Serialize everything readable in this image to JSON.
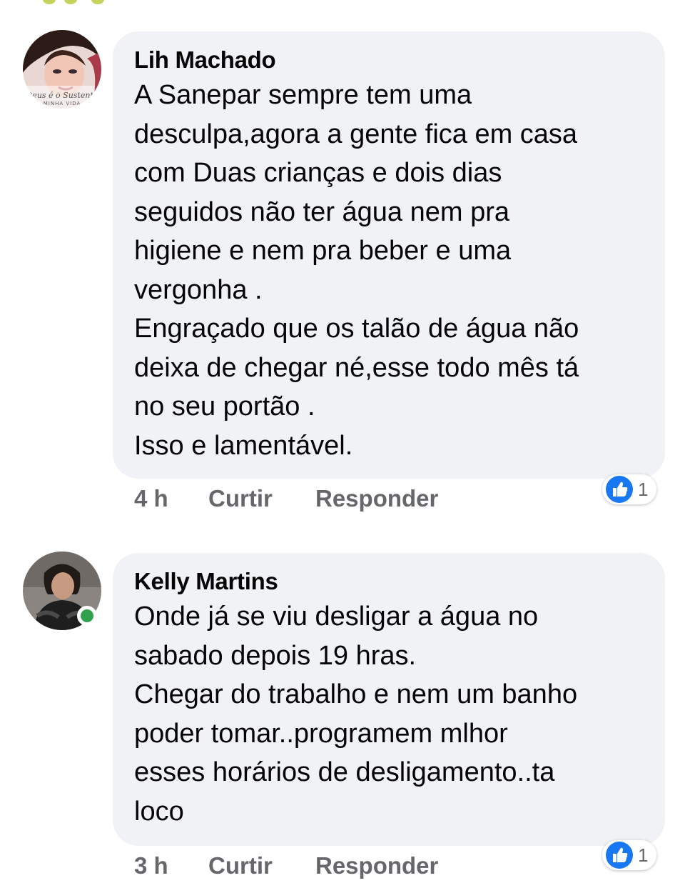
{
  "comments": [
    {
      "author": "Lih Machado",
      "avatar_text": "Deus é o Sustento\nMINHA VIDA",
      "lines": [
        "A Sanepar sempre tem uma",
        "desculpa,agora a gente fica em casa",
        "com Duas crianças e dois dias",
        "seguidos não ter água nem pra",
        "higiene e nem pra beber e uma",
        "vergonha .",
        "Engraçado que os talão de água não",
        "deixa de chegar né,esse todo mês tá",
        "no seu portão .",
        "Isso e lamentável."
      ],
      "time": "4 h",
      "like_label": "Curtir",
      "reply_label": "Responder",
      "reaction_icon": "like-icon",
      "reaction_count": "1",
      "online": false
    },
    {
      "author": "Kelly Martins",
      "lines": [
        "Onde já se viu desligar a água no",
        "sabado depois 19 hras.",
        "Chegar do trabalho e nem um banho",
        "poder tomar..programem  mlhor",
        "esses horários de desligamento..ta",
        "loco"
      ],
      "time": "3 h",
      "like_label": "Curtir",
      "reply_label": "Responder",
      "reaction_icon": "like-icon",
      "reaction_count": "1",
      "online": true
    }
  ],
  "colors": {
    "bubble_bg": "#f0f2f5",
    "meta_text": "#65676b",
    "like_blue": "#1877f2",
    "online_green": "#31a24c"
  }
}
